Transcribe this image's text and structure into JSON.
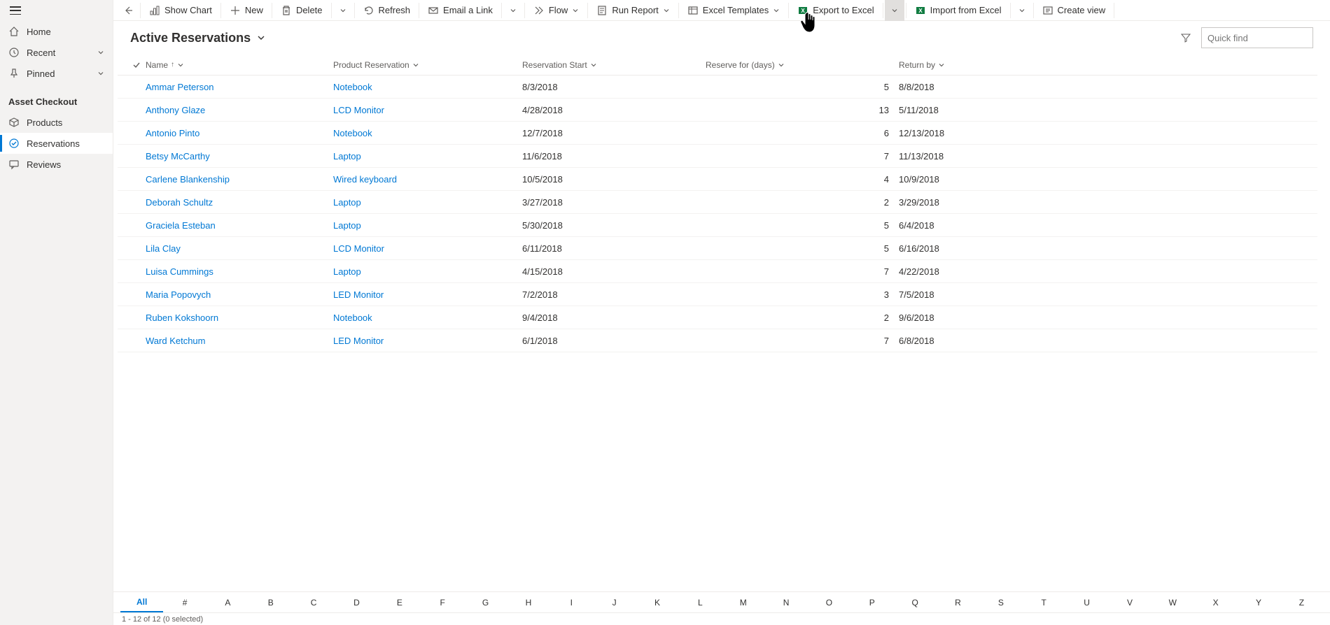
{
  "sidebar": {
    "nav": [
      {
        "icon": "home",
        "label": "Home"
      },
      {
        "icon": "recent",
        "label": "Recent",
        "chevron": true
      },
      {
        "icon": "pin",
        "label": "Pinned",
        "chevron": true
      }
    ],
    "section_header": "Asset Checkout",
    "section_items": [
      {
        "icon": "product",
        "label": "Products"
      },
      {
        "icon": "reservation",
        "label": "Reservations",
        "active": true
      },
      {
        "icon": "review",
        "label": "Reviews"
      }
    ]
  },
  "commandbar": {
    "items": [
      {
        "icon": "chart",
        "label": "Show Chart"
      },
      {
        "icon": "plus",
        "label": "New"
      },
      {
        "icon": "trash",
        "label": "Delete",
        "split": true
      },
      {
        "icon": "refresh",
        "label": "Refresh"
      },
      {
        "icon": "mail",
        "label": "Email a Link",
        "split": true
      },
      {
        "icon": "flow",
        "label": "Flow",
        "chevron": true
      },
      {
        "icon": "report",
        "label": "Run Report",
        "chevron": true
      },
      {
        "icon": "excel-tpl",
        "label": "Excel Templates",
        "chevron": true
      },
      {
        "icon": "excel",
        "label": "Export to Excel",
        "split": true,
        "excel": true,
        "hovered_split": true
      },
      {
        "icon": "excel",
        "label": "Import from Excel",
        "split": true,
        "excel": true
      },
      {
        "icon": "view",
        "label": "Create view"
      }
    ]
  },
  "view": {
    "title": "Active Reservations",
    "search_placeholder": "Quick find"
  },
  "columns": [
    {
      "key": "name",
      "label": "Name",
      "sort": "asc",
      "cls": "col-name"
    },
    {
      "key": "product",
      "label": "Product Reservation",
      "cls": "col-product"
    },
    {
      "key": "start",
      "label": "Reservation Start",
      "cls": "col-start"
    },
    {
      "key": "days",
      "label": "Reserve for (days)",
      "cls": "col-days"
    },
    {
      "key": "return",
      "label": "Return by",
      "cls": "col-return"
    }
  ],
  "rows": [
    {
      "name": "Ammar Peterson",
      "product": "Notebook",
      "start": "8/3/2018",
      "days": "5",
      "return": "8/8/2018"
    },
    {
      "name": "Anthony Glaze",
      "product": "LCD Monitor",
      "start": "4/28/2018",
      "days": "13",
      "return": "5/11/2018"
    },
    {
      "name": "Antonio Pinto",
      "product": "Notebook",
      "start": "12/7/2018",
      "days": "6",
      "return": "12/13/2018"
    },
    {
      "name": "Betsy McCarthy",
      "product": "Laptop",
      "start": "11/6/2018",
      "days": "7",
      "return": "11/13/2018"
    },
    {
      "name": "Carlene Blankenship",
      "product": "Wired keyboard",
      "start": "10/5/2018",
      "days": "4",
      "return": "10/9/2018"
    },
    {
      "name": "Deborah Schultz",
      "product": "Laptop",
      "start": "3/27/2018",
      "days": "2",
      "return": "3/29/2018"
    },
    {
      "name": "Graciela Esteban",
      "product": "Laptop",
      "start": "5/30/2018",
      "days": "5",
      "return": "6/4/2018"
    },
    {
      "name": "Lila Clay",
      "product": "LCD Monitor",
      "start": "6/11/2018",
      "days": "5",
      "return": "6/16/2018"
    },
    {
      "name": "Luisa Cummings",
      "product": "Laptop",
      "start": "4/15/2018",
      "days": "7",
      "return": "4/22/2018"
    },
    {
      "name": "Maria Popovych",
      "product": "LED Monitor",
      "start": "7/2/2018",
      "days": "3",
      "return": "7/5/2018"
    },
    {
      "name": "Ruben Kokshoorn",
      "product": "Notebook",
      "start": "9/4/2018",
      "days": "2",
      "return": "9/6/2018"
    },
    {
      "name": "Ward Ketchum",
      "product": "LED Monitor",
      "start": "6/1/2018",
      "days": "7",
      "return": "6/8/2018"
    }
  ],
  "alpha": [
    "All",
    "#",
    "A",
    "B",
    "C",
    "D",
    "E",
    "F",
    "G",
    "H",
    "I",
    "J",
    "K",
    "L",
    "M",
    "N",
    "O",
    "P",
    "Q",
    "R",
    "S",
    "T",
    "U",
    "V",
    "W",
    "X",
    "Y",
    "Z"
  ],
  "alpha_active": "All",
  "status": "1 - 12 of 12 (0 selected)"
}
